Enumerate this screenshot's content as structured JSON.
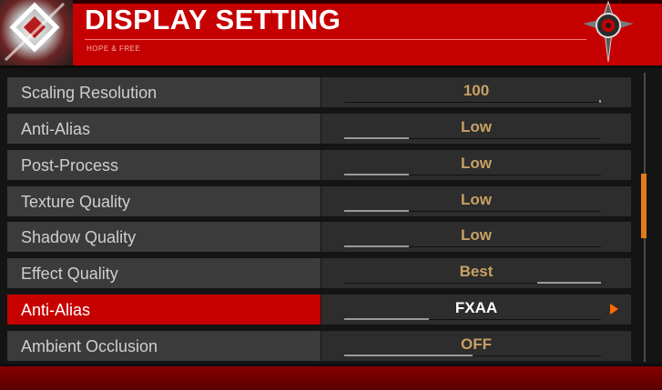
{
  "header": {
    "title": "DISPLAY SETTING",
    "subtitle": "HOPE & FREE",
    "accent_color": "#c50000"
  },
  "settings": [
    {
      "label": "Scaling Resolution",
      "value": "100",
      "level": 0.99
    },
    {
      "label": "Anti-Alias",
      "value": "Low",
      "level": 0.25
    },
    {
      "label": "Post-Process",
      "value": "Low",
      "level": 0.25
    },
    {
      "label": "Texture Quality",
      "value": "Low",
      "level": 0.25
    },
    {
      "label": "Shadow Quality",
      "value": "Low",
      "level": 0.25
    },
    {
      "label": "Effect Quality",
      "value": "Best",
      "level": 1.0
    },
    {
      "label": "Anti-Alias",
      "value": "FXAA",
      "level": 0.33,
      "selected": true
    },
    {
      "label": "Ambient Occlusion",
      "value": "OFF",
      "level": 0.5
    }
  ],
  "scrollbar": {
    "position": 0.45,
    "color": "#e07a1a"
  },
  "icons": {
    "logo": "game-logo-icon",
    "emblem": "emblem-icon",
    "arrow": "arrow-right-icon"
  }
}
